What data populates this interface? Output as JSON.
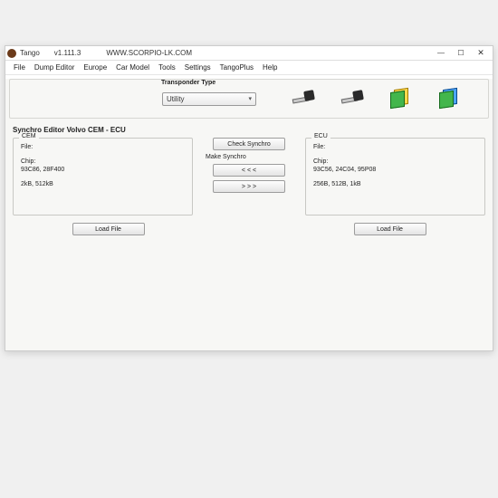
{
  "window": {
    "title": "Tango",
    "version": "v1.111.3",
    "url": "WWW.SCORPIO-LK.COM"
  },
  "menu": {
    "file": "File",
    "dump": "Dump Editor",
    "europe": "Europe",
    "carmodel": "Car Model",
    "tools": "Tools",
    "settings": "Settings",
    "tangoplus": "TangoPlus",
    "help": "Help"
  },
  "toolbar": {
    "transponder_label": "Transponder Type",
    "dropdown_value": "Utility"
  },
  "editor": {
    "title": "Synchro Editor  Volvo CEM - ECU",
    "cem": {
      "title": "CEM",
      "file_label": "File:",
      "chip_label": "Chip:",
      "chip_value": "93C86, 28F400",
      "size_value": "2kB, 512kB"
    },
    "ecu": {
      "title": "ECU",
      "file_label": "File:",
      "chip_label": "Chip:",
      "chip_value": "93C56, 24C04, 95P08",
      "size_value": "256B, 512B, 1kB"
    },
    "center": {
      "check": "Check Synchro",
      "make_label": "Make Synchro",
      "left": "< < <",
      "right": "> > >"
    },
    "load_file": "Load File"
  }
}
